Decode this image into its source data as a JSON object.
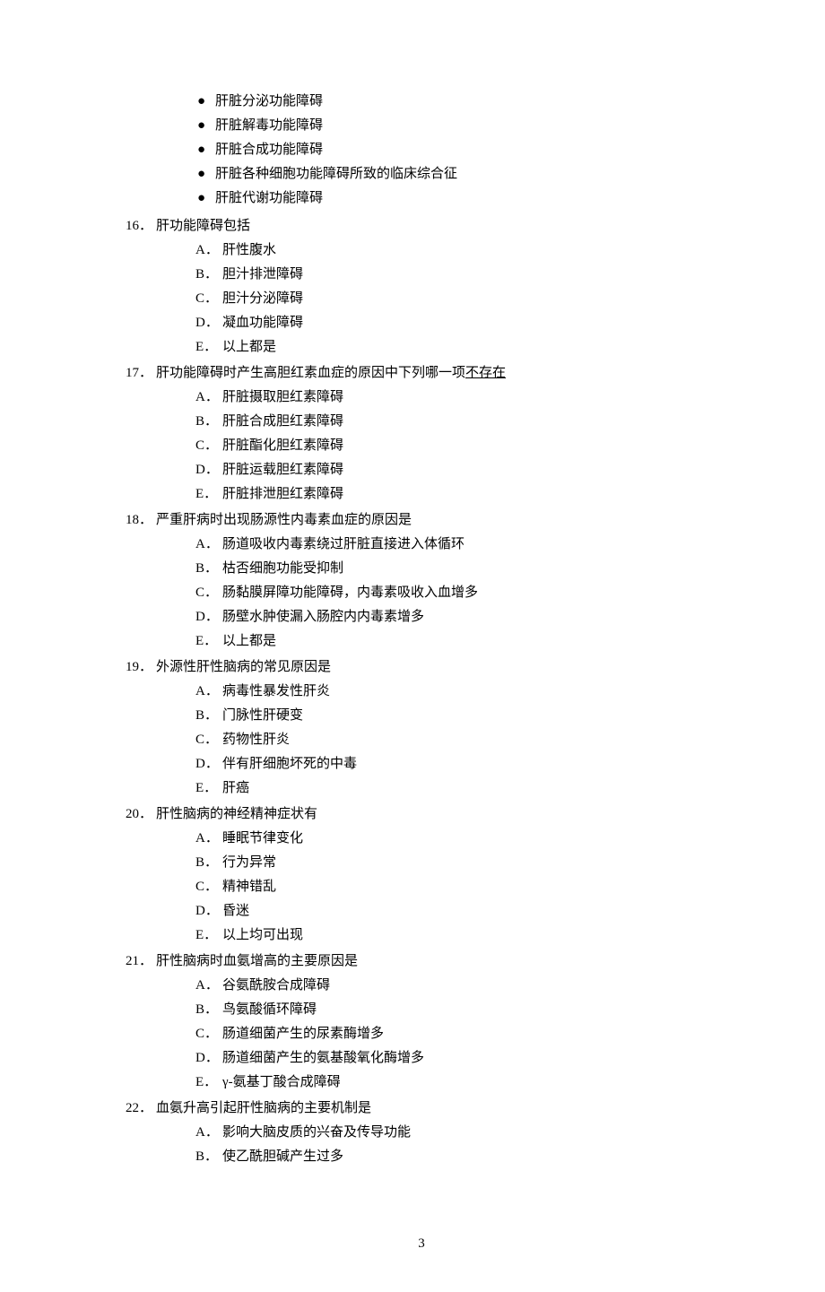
{
  "bullets": [
    "肝脏分泌功能障碍",
    "肝脏解毒功能障碍",
    "肝脏合成功能障碍",
    "肝脏各种细胞功能障碍所致的临床综合征",
    "肝脏代谢功能障碍"
  ],
  "questions": [
    {
      "num": "16．",
      "stem": "肝功能障碍包括",
      "underlined": "",
      "options": [
        {
          "label": "A．",
          "text": "肝性腹水"
        },
        {
          "label": "B．",
          "text": "胆汁排泄障碍"
        },
        {
          "label": "C．",
          "text": "胆汁分泌障碍"
        },
        {
          "label": "D．",
          "text": "凝血功能障碍"
        },
        {
          "label": "E．",
          "text": "以上都是"
        }
      ]
    },
    {
      "num": "17．",
      "stem": "肝功能障碍时产生高胆红素血症的原因中下列哪一项",
      "underlined": "不存在",
      "options": [
        {
          "label": "A．",
          "text": "肝脏摄取胆红素障碍"
        },
        {
          "label": "B．",
          "text": "肝脏合成胆红素障碍"
        },
        {
          "label": "C．",
          "text": "肝脏酯化胆红素障碍"
        },
        {
          "label": "D．",
          "text": "肝脏运载胆红素障碍"
        },
        {
          "label": "E．",
          "text": "肝脏排泄胆红素障碍"
        }
      ]
    },
    {
      "num": "18．",
      "stem": "严重肝病时出现肠源性内毒素血症的原因是",
      "underlined": "",
      "options": [
        {
          "label": "A．",
          "text": "肠道吸收内毒素绕过肝脏直接进入体循环"
        },
        {
          "label": "B．",
          "text": "枯否细胞功能受抑制"
        },
        {
          "label": "C．",
          "text": "肠黏膜屏障功能障碍，内毒素吸收入血增多"
        },
        {
          "label": "D．",
          "text": "肠壁水肿使漏入肠腔内内毒素增多"
        },
        {
          "label": "E．",
          "text": "以上都是"
        }
      ]
    },
    {
      "num": "19．",
      "stem": "外源性肝性脑病的常见原因是",
      "underlined": "",
      "options": [
        {
          "label": "A．",
          "text": "病毒性暴发性肝炎"
        },
        {
          "label": "B．",
          "text": "门脉性肝硬变"
        },
        {
          "label": "C．",
          "text": "药物性肝炎"
        },
        {
          "label": "D．",
          "text": "伴有肝细胞坏死的中毒"
        },
        {
          "label": "E．",
          "text": "肝癌"
        }
      ]
    },
    {
      "num": "20．",
      "stem": "肝性脑病的神经精神症状有",
      "underlined": "",
      "options": [
        {
          "label": "A．",
          "text": "睡眠节律变化"
        },
        {
          "label": "B．",
          "text": "行为异常"
        },
        {
          "label": "C．",
          "text": "精神错乱"
        },
        {
          "label": "D．",
          "text": "昏迷"
        },
        {
          "label": "E．",
          "text": "以上均可出现"
        }
      ]
    },
    {
      "num": "21．",
      "stem": "肝性脑病时血氨增高的主要原因是",
      "underlined": "",
      "options": [
        {
          "label": "A．",
          "text": "谷氨酰胺合成障碍"
        },
        {
          "label": "B．",
          "text": "鸟氨酸循环障碍"
        },
        {
          "label": "C．",
          "text": "肠道细菌产生的尿素酶增多"
        },
        {
          "label": "D．",
          "text": "肠道细菌产生的氨基酸氧化酶增多"
        },
        {
          "label": "E．",
          "text": "γ-氨基丁酸合成障碍"
        }
      ]
    },
    {
      "num": "22．",
      "stem": "血氨升高引起肝性脑病的主要机制是",
      "underlined": "",
      "options_partial": true,
      "options": [
        {
          "label": "A．",
          "text": "影响大脑皮质的兴奋及传导功能"
        },
        {
          "label": "B．",
          "text": "使乙酰胆碱产生过多"
        }
      ]
    }
  ],
  "page_number": "3"
}
